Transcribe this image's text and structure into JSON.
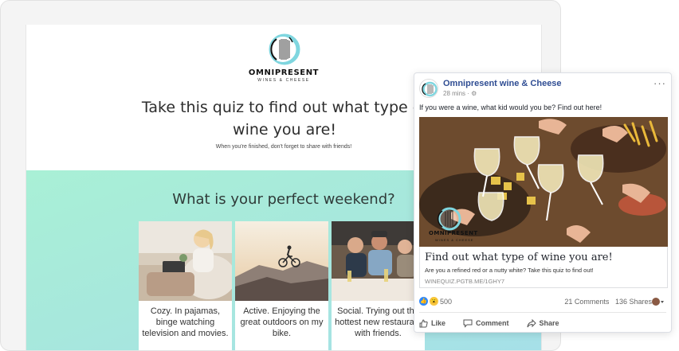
{
  "quiz": {
    "brand_name": "OMNIPRESENT",
    "brand_sub": "WINES & CHEESE",
    "title": "Take this quiz to find out what type of wine you are!",
    "note": "When you're finished, don't forget to share with friends!",
    "question": "What is your perfect weekend?",
    "answers": [
      {
        "caption": "Cozy. In pajamas, binge watching television and movies."
      },
      {
        "caption": "Active. Enjoying the great outdoors on my bike."
      },
      {
        "caption": "Social. Trying out the hottest new restaurant with friends."
      }
    ]
  },
  "fb": {
    "page_name": "Omnipresent wine & Cheese",
    "time": "28 mins · ⚙",
    "more": "···",
    "post_text": "If you were a wine, what kid would you be? Find out here!",
    "image_brand": "OMNIPRESENT",
    "image_brand_sub": "WINES & CHEESE",
    "link_title": "Find out what type of wine you are!",
    "link_desc": "Are you a refined red or a nutty white? Take this quiz to find out!",
    "link_url": "WINEQUIZ.PGTB.ME/1GHY7",
    "reaction_count": "500",
    "comments": "21 Comments",
    "shares": "136 Shares",
    "like_label": "Like",
    "comment_label": "Comment",
    "share_label": "Share"
  },
  "colors": {
    "fb_blue": "#2f4d93",
    "quiz_gradient_start": "#a9f0d6",
    "quiz_gradient_end": "#a6e0e8"
  }
}
